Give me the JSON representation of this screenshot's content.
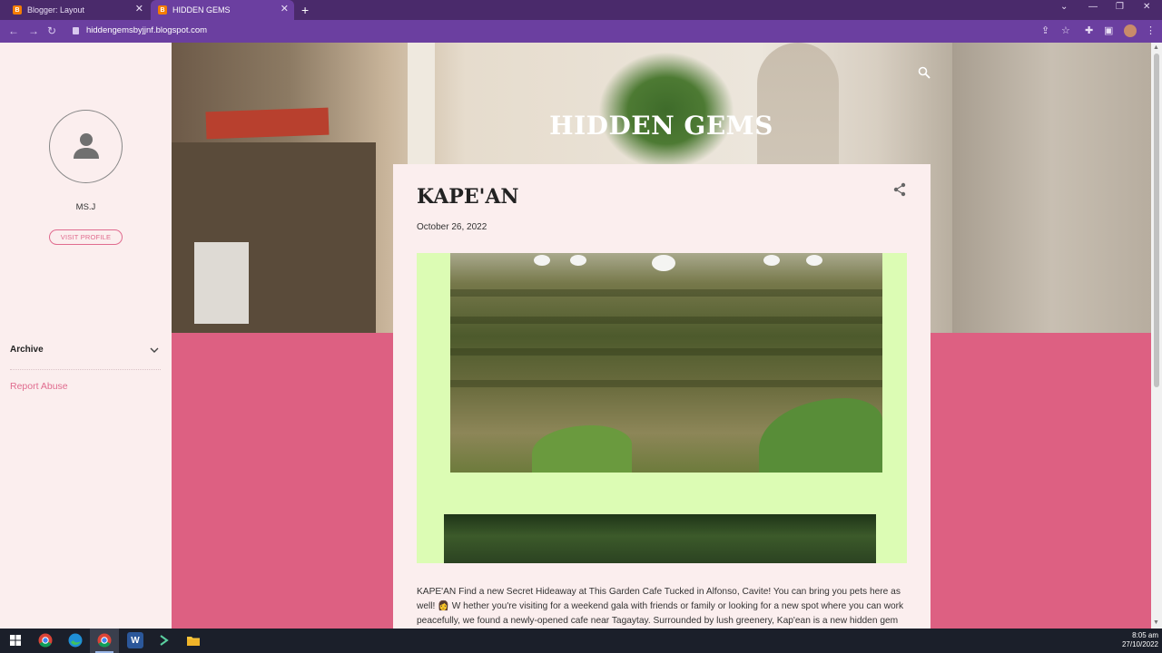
{
  "browser": {
    "tabs": [
      {
        "title": "Blogger: Layout",
        "active": false
      },
      {
        "title": "HIDDEN GEMS",
        "active": true
      }
    ],
    "url": "hiddengemsbyjjnf.blogspot.com",
    "accent_color": "#6b3fa0"
  },
  "sidebar": {
    "profile_name": "MS.J",
    "visit_profile_label": "VISIT PROFILE",
    "archive_label": "Archive",
    "report_abuse_label": "Report Abuse"
  },
  "header": {
    "blog_title": "HIDDEN GEMS"
  },
  "post": {
    "title": "KAPE'AN",
    "date": "October 26, 2022",
    "body": "KAPE'AN Find a new Secret Hideaway at This Garden Cafe  Tucked in Alfonso, Cavite! You can bring you pets here as well! 👩 W hether you're visiting for a weekend gala with friends or family or looking for a new spot where you can work peacefully, we found a newly-opened cafe near Tagaytay. Surrounded by lush greenery, Kap'ean is a new hidden gem worth"
  },
  "colors": {
    "sidebar_bg": "#fbeeee",
    "pink_band": "#dd6082",
    "link_pink": "#e06b8e",
    "image_frame": "#dcfcb4"
  },
  "taskbar": {
    "time": "8:05 am",
    "date": "27/10/2022",
    "apps": [
      "windows-start",
      "chrome",
      "edge",
      "chrome-profile",
      "word",
      "terminal",
      "file-explorer"
    ]
  }
}
